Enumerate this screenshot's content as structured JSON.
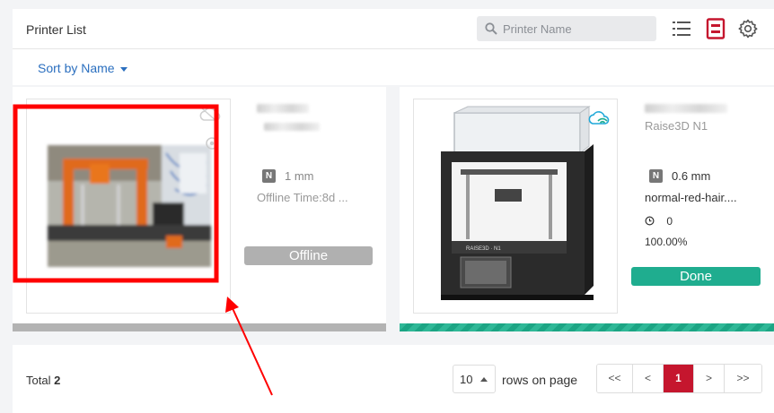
{
  "header": {
    "title": "Printer List",
    "search_placeholder": "Printer Name",
    "icons": [
      "search-icon",
      "list-view-icon",
      "card-view-icon",
      "gear-icon"
    ]
  },
  "sort": {
    "label": "Sort by Name"
  },
  "printers": [
    {
      "nozzle_badge": "N",
      "nozzle": "1 mm",
      "detail": "Offline Time:8d ...",
      "status": "Offline"
    },
    {
      "model": "Raise3D N1",
      "nozzle_badge": "N",
      "nozzle": "0.6 mm",
      "job": "normal-red-hair....",
      "time": "0",
      "progress": "100.00%",
      "status": "Done"
    }
  ],
  "footer": {
    "total_label": "Total",
    "total_value": "2",
    "rows_value": "10",
    "rows_label": "rows on page",
    "pager": [
      "<<",
      "<",
      "1",
      ">",
      ">>"
    ]
  },
  "colors": {
    "accent": "#c5162e",
    "link": "#2b6fbf",
    "done": "#1fad8f",
    "offline": "#b0b0b0",
    "annotation": "#ff0000"
  }
}
